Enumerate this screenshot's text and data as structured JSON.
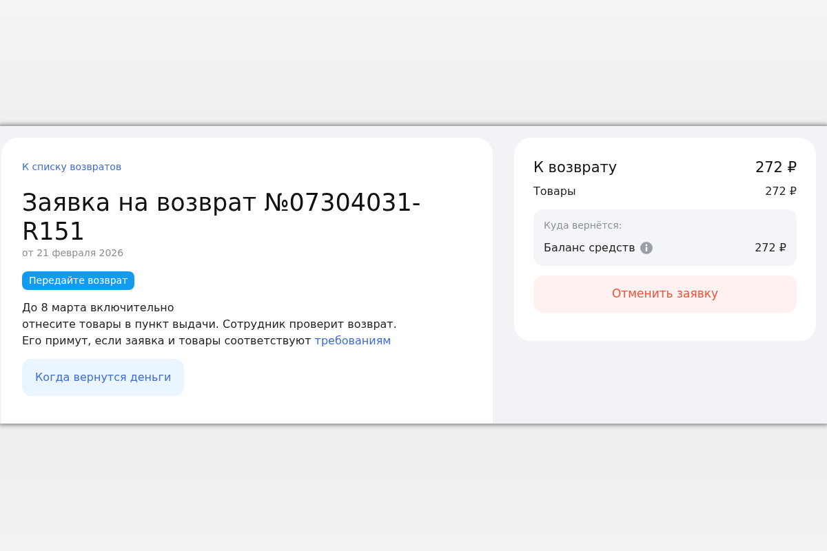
{
  "back_link": "К списку возвратов",
  "title": "Заявка на возврат №07304031-R151",
  "date": "от 21 февраля 2026",
  "status_badge": "Передайте возврат",
  "deadline": "До 8 марта включительно",
  "instructions": {
    "lines": [
      "отнесите товары в пункт выдачи. Сотрудник проверит возврат.",
      "Его примут, если заявка и товары соответствуют"
    ],
    "link": "требованиям"
  },
  "refund_info_button": "Когда вернутся деньги",
  "summary": {
    "total_label": "К возврату",
    "total_value": "272 ₽",
    "goods_label": "Товары",
    "goods_value": "272 ₽",
    "destination": {
      "heading": "Куда вернётся:",
      "label": "Баланс средств",
      "value": "272 ₽"
    },
    "cancel_button": "Отменить заявку"
  }
}
